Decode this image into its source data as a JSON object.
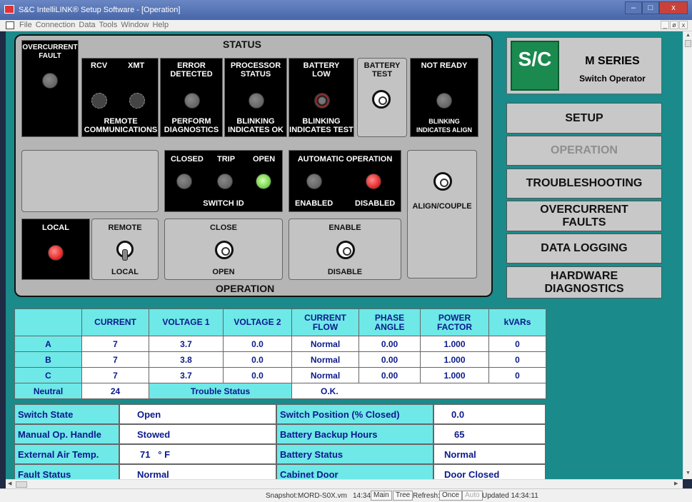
{
  "window": {
    "title": "S&C IntelliLINK® Setup Software - [Operation]",
    "buttons": [
      "–",
      "□",
      "x"
    ]
  },
  "menu": [
    "File",
    "Connection",
    "Data",
    "Tools",
    "Window",
    "Help"
  ],
  "mdi_buttons": [
    "_",
    "ø",
    "x"
  ],
  "status_section": {
    "header": "STATUS",
    "overcurrent": "OVERCURRENT\nFAULT",
    "rcv": "RCV",
    "xmt": "XMT",
    "remote_comm": "REMOTE\nCOMMUNICATIONS",
    "error_detected": "ERROR\nDETECTED",
    "perform_diag": "PERFORM\nDIAGNOSTICS",
    "processor_status": "PROCESSOR\nSTATUS",
    "blinking_ok": "BLINKING\nINDICATES OK",
    "battery_low": "BATTERY\nLOW",
    "blinking_test": "BLINKING\nINDICATES TEST",
    "battery_test": "BATTERY\nTEST",
    "not_ready": "NOT READY",
    "blinking_align": "BLINKING\nINDICATES ALIGN"
  },
  "operation_section": {
    "header": "OPERATION",
    "closed": "CLOSED",
    "trip": "TRIP",
    "open": "OPEN",
    "switch_id": "SWITCH ID",
    "auto_op": "AUTOMATIC OPERATION",
    "enabled": "ENABLED",
    "disabled": "DISABLED",
    "align_couple": "ALIGN/COUPLE",
    "local": "LOCAL",
    "remote": "REMOTE",
    "local2": "LOCAL",
    "close": "CLOSE",
    "open2": "OPEN",
    "enable": "ENABLE",
    "disable": "DISABLE"
  },
  "brand": {
    "logo": "S/C",
    "title": "M SERIES",
    "subtitle": "Switch Operator"
  },
  "nav": {
    "setup": "SETUP",
    "operation": "OPERATION",
    "troubleshooting": "TROUBLESHOOTING",
    "overcurrent": "OVERCURRENT\nFAULTS",
    "data_logging": "DATA LOGGING",
    "hardware": "HARDWARE\nDIAGNOSTICS"
  },
  "table": {
    "headers": [
      "CURRENT",
      "VOLTAGE 1",
      "VOLTAGE 2",
      "CURRENT\nFLOW",
      "PHASE\nANGLE",
      "POWER\nFACTOR",
      "kVARs"
    ],
    "rows": [
      {
        "phase": "A",
        "cells": [
          "7",
          "3.7",
          "0.0",
          "Normal",
          "0.00",
          "1.000",
          "0"
        ]
      },
      {
        "phase": "B",
        "cells": [
          "7",
          "3.8",
          "0.0",
          "Normal",
          "0.00",
          "1.000",
          "0"
        ]
      },
      {
        "phase": "C",
        "cells": [
          "7",
          "3.7",
          "0.0",
          "Normal",
          "0.00",
          "1.000",
          "0"
        ]
      }
    ],
    "neutral_label": "Neutral",
    "neutral_value": "24",
    "trouble_label": "Trouble Status",
    "trouble_value": "O.K."
  },
  "info": {
    "switch_state_label": "Switch State",
    "switch_state_value": "Open",
    "switch_position_label": "Switch Position (% Closed)",
    "switch_position_value": "0.0",
    "manual_op_label": "Manual Op. Handle",
    "manual_op_value": "Stowed",
    "battery_hours_label": "Battery Backup Hours",
    "battery_hours_value": "65",
    "air_temp_label": "External Air Temp.",
    "air_temp_value": "71   ° F",
    "battery_status_label": "Battery Status",
    "battery_status_value": "Normal",
    "fault_status_label": "Fault Status",
    "fault_status_value": "Normal",
    "cabinet_label": "Cabinet Door",
    "cabinet_value": "Door Closed"
  },
  "statusbar": {
    "snapshot": "Snapshot:MORD-S0X.vm",
    "time": "14:34",
    "main": "Main",
    "tree": "Tree",
    "refresh": "Refresh:",
    "once": "Once",
    "auto": "Auto",
    "updated": "Updated 14:34:11"
  }
}
